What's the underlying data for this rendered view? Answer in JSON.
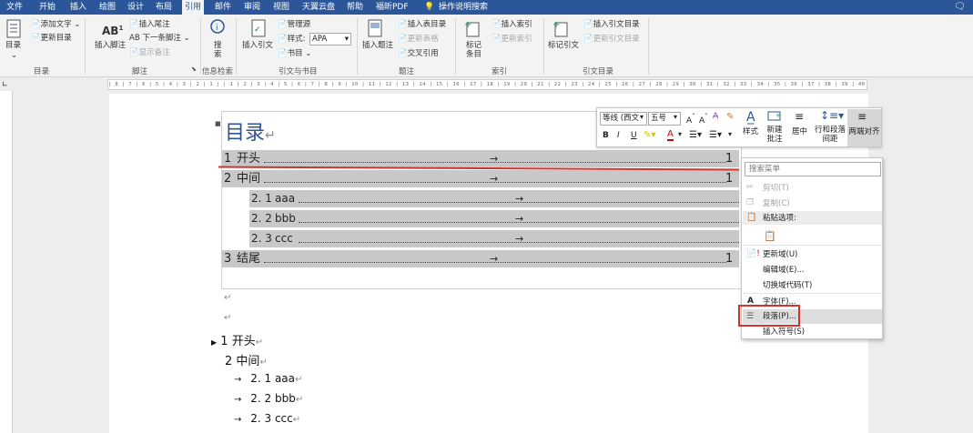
{
  "tabs": [
    "文件",
    "开始",
    "插入",
    "绘图",
    "设计",
    "布局",
    "引用",
    "邮件",
    "审阅",
    "视图",
    "天翼云盘",
    "帮助",
    "福昕PDF",
    "操作说明搜索"
  ],
  "active_tab": "引用",
  "ribbon": {
    "toc": {
      "big": "目录",
      "add_text": "添加文字",
      "update": "更新目录",
      "group": "目录"
    },
    "footnote": {
      "insert_footnote": "插入脚注",
      "insert_endnote": "插入尾注",
      "next": "下一条脚注",
      "show": "显示备注",
      "group": "脚注"
    },
    "research": {
      "search": "搜索",
      "group": "信息检索"
    },
    "citation": {
      "insert": "插入引文",
      "manage": "管理源",
      "style_label": "样式:",
      "style_value": "APA",
      "bibliography": "书目",
      "group": "引文与书目"
    },
    "caption": {
      "insert": "插入题注",
      "table_of_figures": "插入表目录",
      "update_table": "更新表格",
      "cross_ref": "交叉引用",
      "group": "题注"
    },
    "index": {
      "mark": "标记条目",
      "insert": "插入索引",
      "update": "更新索引",
      "group": "索引"
    },
    "authorities": {
      "mark": "标记引文",
      "insert": "插入引文目录",
      "update": "更新引文目录",
      "group": "引文目录"
    }
  },
  "ruler_text": "| 8 | 7 | 6 | 5 | 4 | 3 | 2 | 1 |   | 1 | 2 | 3 | 4 | 5 | 6 | 7 | 8 | 9 | 10 | 11 | 12 | 13 | 14 | 15 | 16 | 17 | 18 | 19 | 20 | 21 | 22 | 23 | 24 | 25 | 26 | 27 | 28 | 29 | 30 | 31 | 32 | 33 | 34 | 35 | 36 | 37 | 38 | 39 | 40 | 41 | 42 | 43 | 44 | 45 | 46 | 47 | 48",
  "document": {
    "toc_title": "目录",
    "toc_lines": [
      {
        "num": "1",
        "text": "开头",
        "page": "1"
      },
      {
        "num": "2",
        "text": "中间",
        "page": "1"
      },
      {
        "num": "2. 1",
        "text": "aaa",
        "page": ""
      },
      {
        "num": "2. 2",
        "text": "bbb",
        "page": ""
      },
      {
        "num": "2. 3",
        "text": "ccc",
        "page": ""
      },
      {
        "num": "3",
        "text": "结尾",
        "page": "1"
      }
    ],
    "tab_arrow": "→",
    "para_mark": "↵",
    "headings": [
      {
        "num": "1",
        "text": "开头"
      },
      {
        "num": "2",
        "text": "中间"
      },
      {
        "num": "2. 1",
        "text": "aaa"
      },
      {
        "num": "2. 2",
        "text": "bbb"
      },
      {
        "num": "2. 3",
        "text": "ccc"
      }
    ]
  },
  "mini_toolbar": {
    "font": "等线 (西文",
    "size": "五号",
    "style": "样式",
    "new_comment": "新建批注",
    "center": "居中",
    "line_spacing": "行和段落间距",
    "justify": "两端对齐"
  },
  "context_menu": {
    "search_placeholder": "搜索菜单",
    "cut": "剪切(T)",
    "copy": "复制(C)",
    "paste_options": "粘贴选项:",
    "update_field": "更新域(U)",
    "edit_field": "编辑域(E)...",
    "toggle_codes": "切换域代码(T)",
    "font": "字体(F)...",
    "paragraph": "段落(P)...",
    "insert_symbol": "插入符号(S)"
  },
  "colors": {
    "accent": "#2b579a",
    "highlight": "#c8c8c8",
    "selection_frame": "#d0342c",
    "title": "#2f5496"
  }
}
